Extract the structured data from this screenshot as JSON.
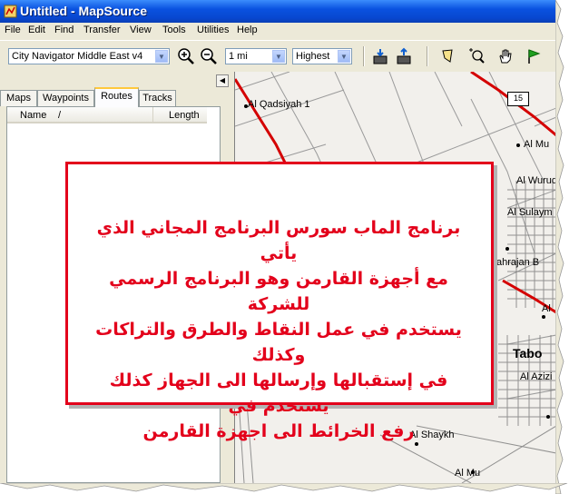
{
  "window": {
    "title": "Untitled - MapSource"
  },
  "menu": [
    "File",
    "Edit",
    "Find",
    "Transfer",
    "View",
    "Tools",
    "Utilities",
    "Help"
  ],
  "toolbar": {
    "map_product": "City Navigator Middle East v4",
    "zoom_level": "1 mi",
    "detail_level": "Highest"
  },
  "tabs": [
    {
      "label": "Maps",
      "active": false
    },
    {
      "label": "Waypoints",
      "active": false
    },
    {
      "label": "Routes",
      "active": true
    },
    {
      "label": "Tracks",
      "active": false
    }
  ],
  "list": {
    "col_name": "Name",
    "col_sort": "/",
    "col_length": "Length"
  },
  "map": {
    "route_shield": "15",
    "labels": [
      "Al Qadsiyah 1",
      "Al Mu",
      "Al Wurud",
      "Al Sulaym",
      "ahrajan B",
      "Al",
      "Tabo",
      "Al Azizi",
      "Al Shaykh",
      "Al Mu"
    ]
  },
  "overlay": {
    "text_lines": [
      "برنامج الماب سورس البرنامج المجاني الذي يأتي",
      "مع أجهزة القارمن وهو البرنامج الرسمي للشركة",
      "يستخدم في عمل النقاط والطرق والتراكات وكذلك",
      "في إستقبالها وإرسالها الى الجهاز كذلك يستخدم في",
      "رفع الخرائط الى اجهزة القارمن"
    ]
  },
  "colors": {
    "titlebar": "#0a52e0",
    "overlay_border": "#e3001b",
    "overlay_text": "#e3001b",
    "major_road": "#d40000"
  }
}
